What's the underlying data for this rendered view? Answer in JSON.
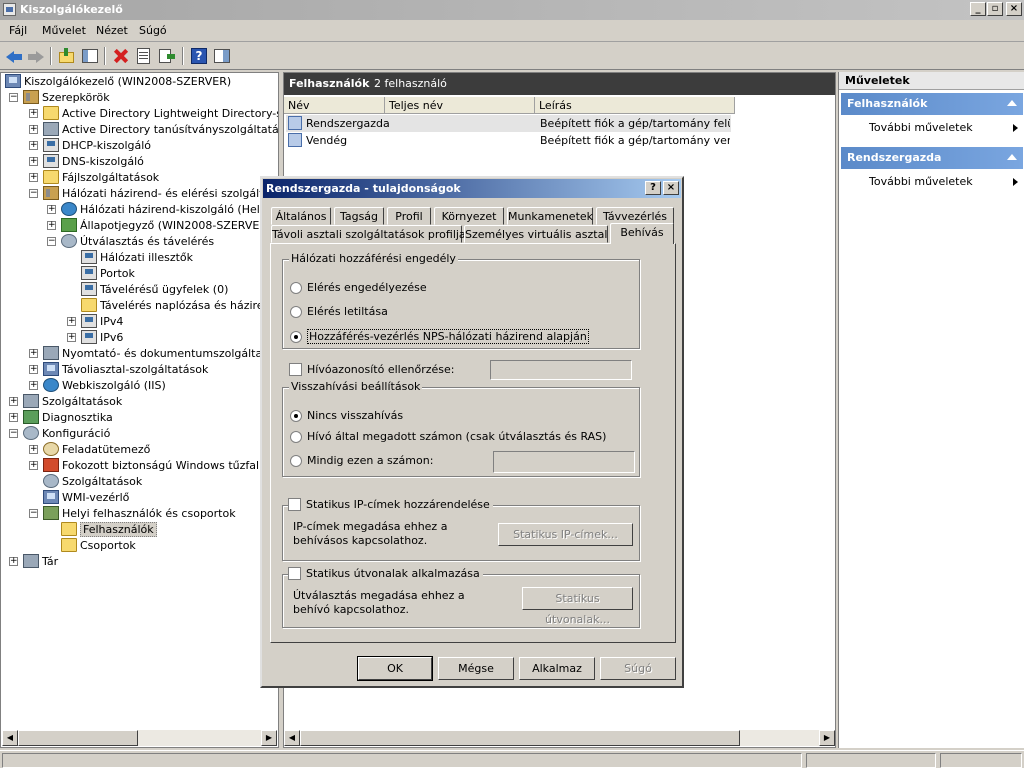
{
  "window": {
    "title": "Kiszolgálókezelő",
    "min": "_",
    "max": "▫",
    "close": "×"
  },
  "menu": [
    "Fájl",
    "Művelet",
    "Nézet",
    "Súgó"
  ],
  "tree": {
    "items": [
      "Kiszolgálókezelő (WIN2008-SZERVER)",
      "Szerepkörök",
      "Active Directory Lightweight Directory-szolgá",
      "Active Directory tanúsítványszolgáltatások",
      "DHCP-kiszolgáló",
      "DNS-kiszolgáló",
      "Fájlszolgáltatások",
      "Hálózati házirend- és elérési szolgáltatáso",
      "Hálózati házirend-kiszolgáló (Helyi)",
      "Állapotjegyző (WIN2008-SZERVER)",
      "Útválasztás és távelérés",
      "Hálózati illesztők",
      "Portok",
      "Távelérésű ügyfelek (0)",
      "Távelérés naplózása és házirendj",
      "IPv4",
      "IPv6",
      "Nyomtató- és dokumentumszolgáltatások",
      "Távoliasztal-szolgáltatások",
      "Webkiszolgáló (IIS)",
      "Szolgáltatások",
      "Diagnosztika",
      "Konfiguráció",
      "Feladatütemező",
      "Fokozott biztonságú Windows tűzfal",
      "Szolgáltatások",
      "WMI-vezérlő",
      "Helyi felhasználók és csoportok",
      "Felhasználók",
      "Csoportok",
      "Tár"
    ]
  },
  "center": {
    "header_title": "Felhasználók",
    "header_count": "2 felhasználó",
    "columns": [
      "Név",
      "Teljes név",
      "Leírás"
    ],
    "rows": [
      {
        "name": "Rendszergazda",
        "full": "",
        "desc": "Beépített fiók a gép/tartomány felüg..."
      },
      {
        "name": "Vendég",
        "full": "",
        "desc": "Beépített fiók a gép/tartomány vend..."
      }
    ]
  },
  "actions": {
    "title": "Műveletek",
    "sections": [
      {
        "title": "Felhasználók",
        "item": "További műveletek"
      },
      {
        "title": "Rendszergazda",
        "item": "További műveletek"
      }
    ]
  },
  "dialog": {
    "title": "Rendszergazda - tulajdonságok",
    "help_btn": "?",
    "close_btn": "×",
    "tabs_row1": [
      "Általános",
      "Tagság",
      "Profil",
      "Környezet",
      "Munkamenetek",
      "Távvezérlés"
    ],
    "tabs_row2": [
      "Távoli asztali szolgáltatások profilja",
      "Személyes virtuális asztal",
      "Behívás"
    ],
    "network_group": "Hálózati hozzáférési engedély",
    "radio_allow": "Elérés engedélyezése",
    "radio_deny": "Elérés letiltása",
    "radio_nps": "Hozzáférés-vezérlés NPS-hálózati házirend alapján",
    "chk_callerid": "Hívóazonosító ellenőrzése:",
    "callback_group": "Visszahívási beállítások",
    "radio_nocallback": "Nincs visszahívás",
    "radio_callerset": "Hívó által megadott számon (csak útválasztás és RAS)",
    "radio_always": "Mindig ezen a számon:",
    "chk_staticip": "Statikus IP-címek hozzárendelése",
    "staticip_text": "IP-címek megadása ehhez a behívásos kapcsolathoz.",
    "btn_staticip": "Statikus IP-címek...",
    "chk_routes": "Statikus útvonalak alkalmazása",
    "routes_text": "Útválasztás megadása ehhez a behívó kapcsolathoz.",
    "btn_routes": "Statikus útvonalak...",
    "btn_ok": "OK",
    "btn_cancel": "Mégse",
    "btn_apply": "Alkalmaz",
    "btn_help": "Súgó"
  }
}
